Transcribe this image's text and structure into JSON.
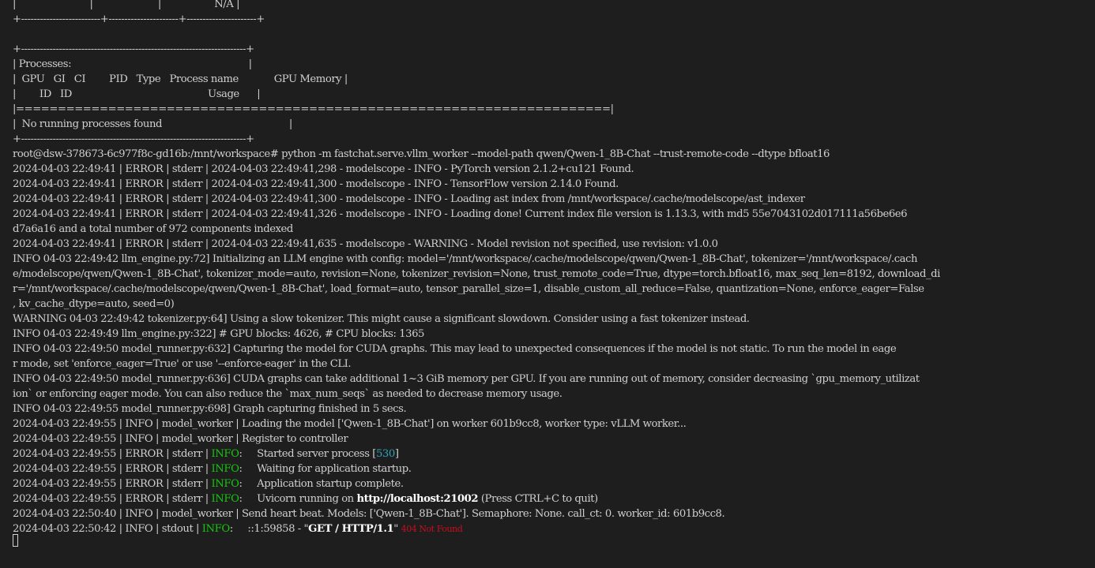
{
  "terminal": {
    "nvidia_smi": [
      "|                         |                      |                  N/A |",
      "+-------------------------+----------------------+----------------------+",
      "",
      "+-----------------------------------------------------------------------+",
      "| Processes:                                                            |",
      "|  GPU   GI   CI        PID   Type   Process name            GPU Memory |",
      "|        ID   ID                                              Usage      |",
      "|=======================================================================|",
      "|  No running processes found                                           |",
      "+-----------------------------------------------------------------------+"
    ],
    "command": "root@dsw-378673-6c977f8c-gd16b:/mnt/workspace# python -m fastchat.serve.vllm_worker --model-path qwen/Qwen-1_8B-Chat --trust-remote-code --dtype bfloat16",
    "log": [
      "2024-04-03 22:49:41 | ERROR | stderr | 2024-04-03 22:49:41,298 - modelscope - INFO - PyTorch version 2.1.2+cu121 Found.",
      "2024-04-03 22:49:41 | ERROR | stderr | 2024-04-03 22:49:41,300 - modelscope - INFO - TensorFlow version 2.14.0 Found.",
      "2024-04-03 22:49:41 | ERROR | stderr | 2024-04-03 22:49:41,300 - modelscope - INFO - Loading ast index from /mnt/workspace/.cache/modelscope/ast_indexer",
      "2024-04-03 22:49:41 | ERROR | stderr | 2024-04-03 22:49:41,326 - modelscope - INFO - Loading done! Current index file version is 1.13.3, with md5 55e7043102d017111a56be6e6",
      "d7a6a16 and a total number of 972 components indexed",
      "2024-04-03 22:49:41 | ERROR | stderr | 2024-04-03 22:49:41,635 - modelscope - WARNING - Model revision not specified, use revision: v1.0.0",
      "INFO 04-03 22:49:42 llm_engine.py:72] Initializing an LLM engine with config: model='/mnt/workspace/.cache/modelscope/qwen/Qwen-1_8B-Chat', tokenizer='/mnt/workspace/.cach",
      "e/modelscope/qwen/Qwen-1_8B-Chat', tokenizer_mode=auto, revision=None, tokenizer_revision=None, trust_remote_code=True, dtype=torch.bfloat16, max_seq_len=8192, download_di",
      "r='/mnt/workspace/.cache/modelscope/qwen/Qwen-1_8B-Chat', load_format=auto, tensor_parallel_size=1, disable_custom_all_reduce=False, quantization=None, enforce_eager=False",
      ", kv_cache_dtype=auto, seed=0)",
      "WARNING 04-03 22:49:42 tokenizer.py:64] Using a slow tokenizer. This might cause a significant slowdown. Consider using a fast tokenizer instead.",
      "INFO 04-03 22:49:49 llm_engine.py:322] # GPU blocks: 4626, # CPU blocks: 1365",
      "INFO 04-03 22:49:50 model_runner.py:632] Capturing the model for CUDA graphs. This may lead to unexpected consequences if the model is not static. To run the model in eage",
      "r mode, set 'enforce_eager=True' or use '--enforce-eager' in the CLI.",
      "INFO 04-03 22:49:50 model_runner.py:636] CUDA graphs can take additional 1~3 GiB memory per GPU. If you are running out of memory, consider decreasing `gpu_memory_utilizat",
      "ion` or enforcing eager mode. You can also reduce the `max_num_seqs` as needed to decrease memory usage.",
      "INFO 04-03 22:49:55 model_runner.py:698] Graph capturing finished in 5 secs.",
      "2024-04-03 22:49:55 | INFO | model_worker | Loading the model ['Qwen-1_8B-Chat'] on worker 601b9cc8, worker type: vLLM worker...",
      "2024-04-03 22:49:55 | INFO | model_worker | Register to controller"
    ],
    "uvicorn_prefix": "2024-04-03 22:49:55 | ERROR | stderr | ",
    "uvicorn_level": "INFO",
    "uvicorn_gap": ":     ",
    "uvicorn_started": "Started server process [",
    "uvicorn_pid": "530",
    "uvicorn_started_end": "]",
    "uvicorn_waiting": "Waiting for application startup.",
    "uvicorn_complete": "Application startup complete.",
    "uvicorn_running": "Uvicorn running on ",
    "uvicorn_url": "http://localhost:21002",
    "uvicorn_running_end": " (Press CTRL+C to quit)",
    "heartbeat": "2024-04-03 22:50:40 | INFO | model_worker | Send heart beat. Models: ['Qwen-1_8B-Chat']. Semaphore: None. call_ct: 0. worker_id: 601b9cc8.",
    "stdout_prefix": "2024-04-03 22:50:42 | INFO | stdout | ",
    "stdout_gap": ":     ::1:59858 - \"",
    "stdout_request": "GET / HTTP/1.1",
    "stdout_quote": "\" ",
    "stdout_status": "404 Not Found"
  }
}
